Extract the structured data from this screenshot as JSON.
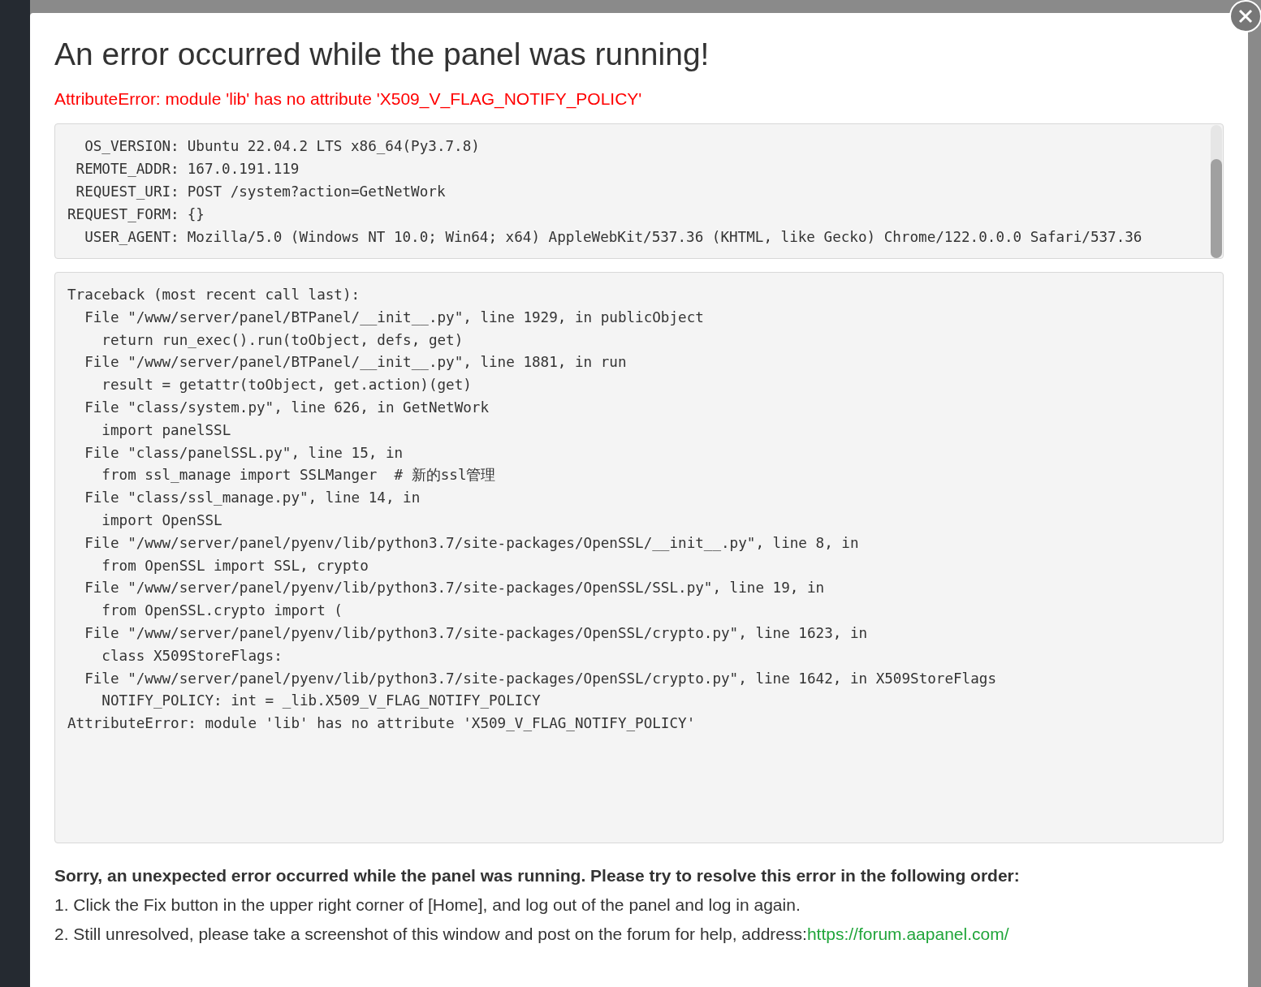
{
  "dialog": {
    "title": "An error occurred while the panel was running!",
    "error_message": "AttributeError: module 'lib' has no attribute 'X509_V_FLAG_NOTIFY_POLICY'",
    "request_info": [
      {
        "label": "OS_VERSION:",
        "value": "Ubuntu 22.04.2 LTS x86_64(Py3.7.8)"
      },
      {
        "label": "REMOTE_ADDR:",
        "value": "167.0.191.119"
      },
      {
        "label": "REQUEST_URI:",
        "value": "POST /system?action=GetNetWork"
      },
      {
        "label": "REQUEST_FORM:",
        "value": "{}"
      },
      {
        "label": "USER_AGENT:",
        "value": "Mozilla/5.0 (Windows NT 10.0; Win64; x64) AppleWebKit/537.36 (KHTML, like Gecko) Chrome/122.0.0.0 Safari/537.36"
      }
    ],
    "traceback": [
      "Traceback (most recent call last):",
      "  File \"/www/server/panel/BTPanel/__init__.py\", line 1929, in publicObject",
      "    return run_exec().run(toObject, defs, get)",
      "  File \"/www/server/panel/BTPanel/__init__.py\", line 1881, in run",
      "    result = getattr(toObject, get.action)(get)",
      "  File \"class/system.py\", line 626, in GetNetWork",
      "    import panelSSL",
      "  File \"class/panelSSL.py\", line 15, in",
      "    from ssl_manage import SSLManger  # 新的ssl管理",
      "  File \"class/ssl_manage.py\", line 14, in",
      "    import OpenSSL",
      "  File \"/www/server/panel/pyenv/lib/python3.7/site-packages/OpenSSL/__init__.py\", line 8, in",
      "    from OpenSSL import SSL, crypto",
      "  File \"/www/server/panel/pyenv/lib/python3.7/site-packages/OpenSSL/SSL.py\", line 19, in",
      "    from OpenSSL.crypto import (",
      "  File \"/www/server/panel/pyenv/lib/python3.7/site-packages/OpenSSL/crypto.py\", line 1623, in",
      "    class X509StoreFlags:",
      "  File \"/www/server/panel/pyenv/lib/python3.7/site-packages/OpenSSL/crypto.py\", line 1642, in X509StoreFlags",
      "    NOTIFY_POLICY: int = _lib.X509_V_FLAG_NOTIFY_POLICY",
      "AttributeError: module 'lib' has no attribute 'X509_V_FLAG_NOTIFY_POLICY'"
    ],
    "help_heading": "Sorry, an unexpected error occurred while the panel was running. Please try to resolve this error in the following order:",
    "help_steps": [
      {
        "text": "1. Click the Fix button in the upper right corner of [Home], and log out of the panel and log in again."
      },
      {
        "text": "2. Still unresolved, please take a screenshot of this window and post on the forum for help, address:",
        "link": "https://forum.aapanel.com/"
      }
    ]
  }
}
